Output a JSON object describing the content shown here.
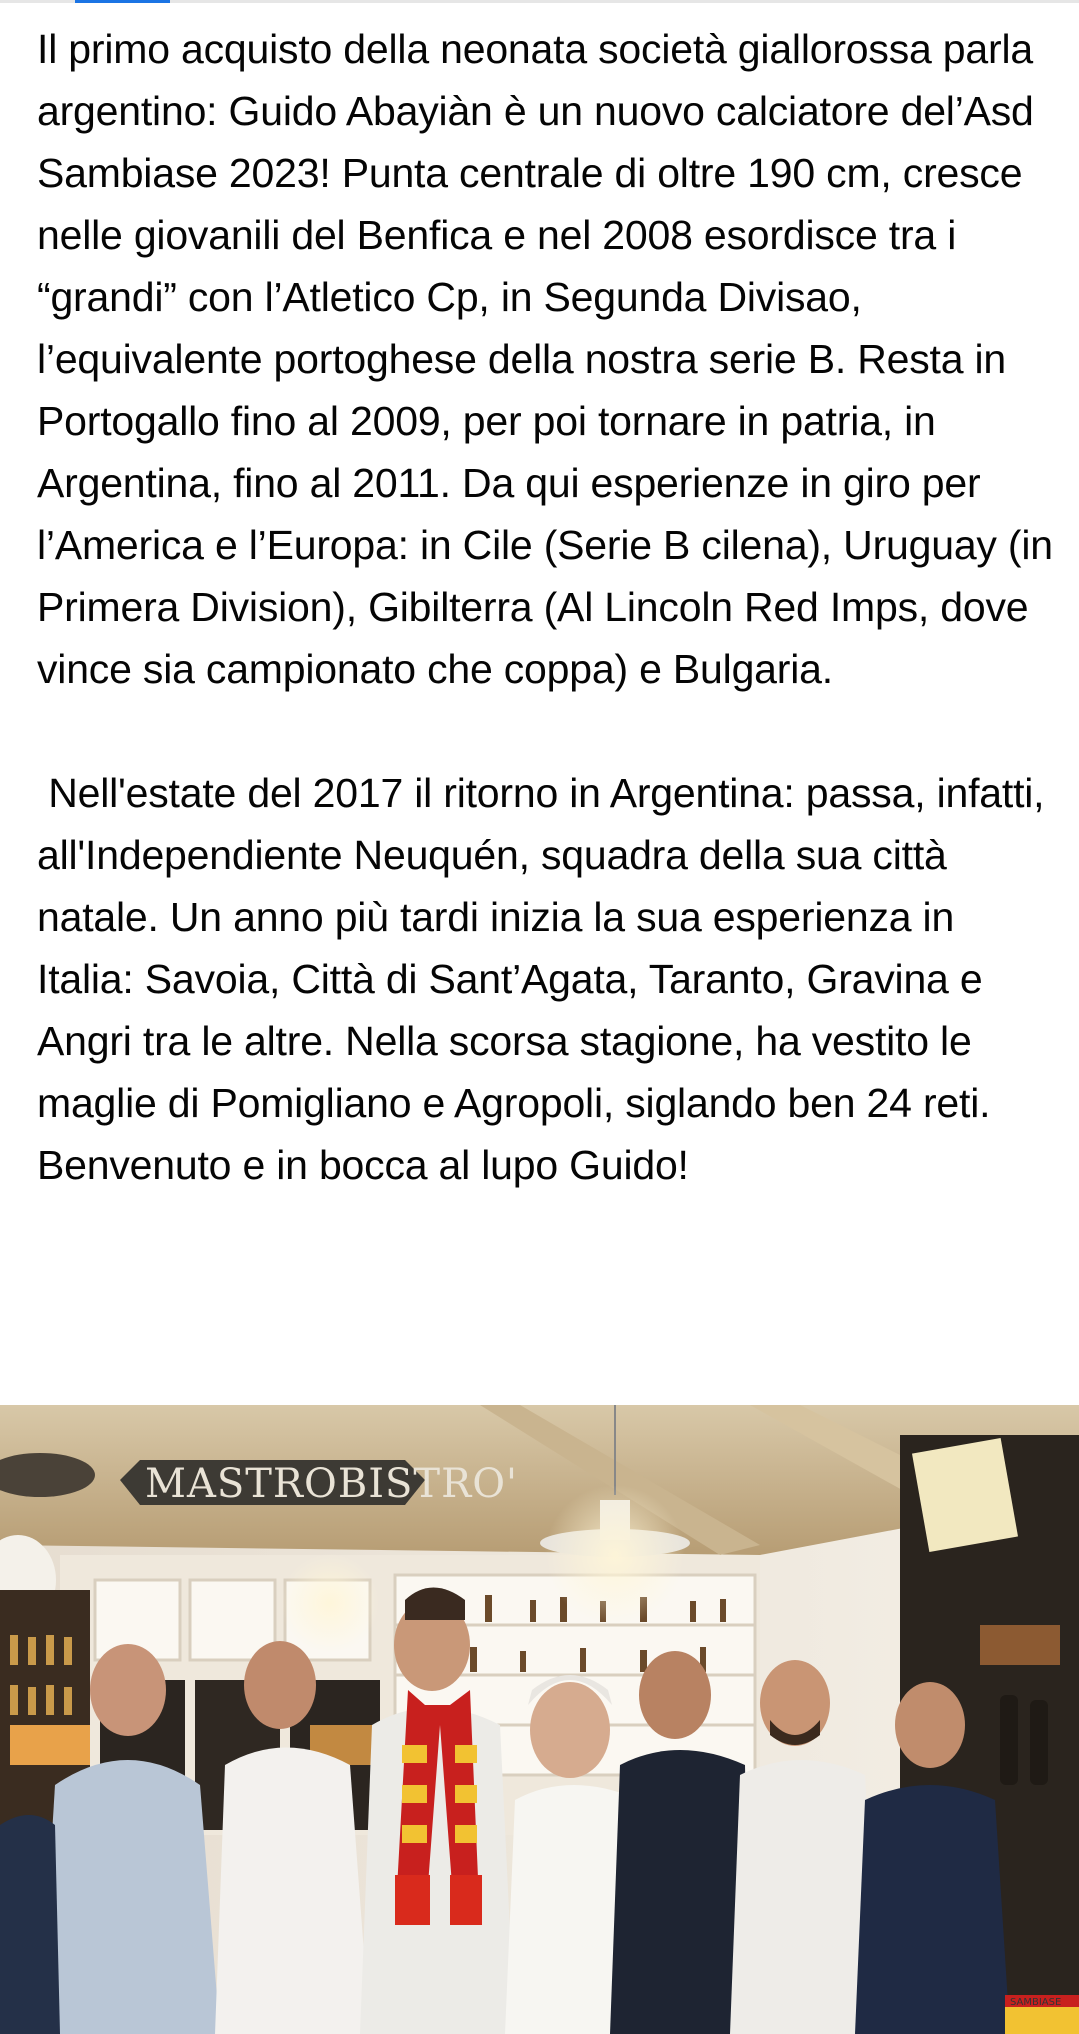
{
  "post": {
    "paragraphs": [
      "Il primo acquisto della neonata società giallorossa parla argentino: Guido Abayiàn è un nuovo calciatore del’Asd Sambiase 2023! Punta centrale di oltre 190 cm, cresce nelle giovanili del Benfica e nel 2008 esordisce tra i “grandi” con l’Atletico Cp, in Segunda Divisao, l’equivalente portoghese della nostra serie B. Resta in Portogallo fino al 2009, per poi tornare in patria, in Argentina, fino al 2011. Da qui esperienze in giro per l’America e l’Europa: in Cile (Serie B cilena), Uruguay (in Primera Division), Gibilterra (Al Lincoln Red Imps, dove vince sia campionato che coppa) e Bulgaria.",
      " Nell'estate del 2017 il ritorno in Argentina: passa, infatti, all'Independiente Neuquén, squadra della sua città natale. Un anno più tardi inizia la sua esperienza in Italia: Savoia, Città di Sant’Agata, Taranto, Gravina e Angri tra le altre. Nella scorsa stagione, ha vestito le maglie di Pomigliano e Agropoli, siglando ben 24 reti. Benvenuto e in bocca al lupo Guido!"
    ]
  },
  "photo": {
    "sign_text": "MASTROBISTRO'",
    "badge_text": "SAMBIASE"
  },
  "colors": {
    "text": "#050505",
    "accent": "#1b74e4",
    "scarf_red": "#c8201e",
    "scarf_yellow": "#f2c232"
  }
}
